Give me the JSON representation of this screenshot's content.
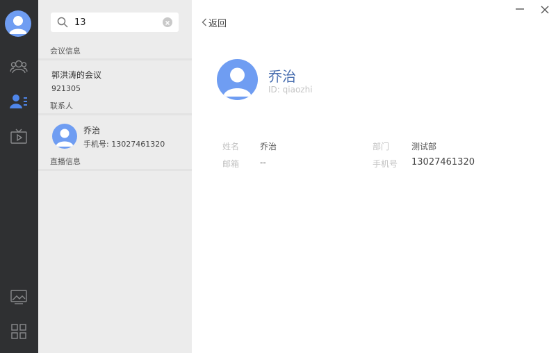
{
  "search": {
    "value": "13"
  },
  "sections": {
    "meetings": "会议信息",
    "contacts": "联系人",
    "live": "直播信息"
  },
  "meeting": {
    "name": "郭洪涛的会议",
    "number": "921305"
  },
  "contact": {
    "name": "乔治",
    "phone_label": "手机号:",
    "phone": "13027461320"
  },
  "back_label": "返回",
  "profile": {
    "name": "乔治",
    "id_label": "ID:",
    "id": "qiaozhi",
    "fields": [
      {
        "label": "姓名",
        "value": "乔治"
      },
      {
        "label": "部门",
        "value": "测试部"
      },
      {
        "label": "邮箱",
        "value": "--"
      },
      {
        "label": "手机号",
        "value": "13027461320"
      }
    ]
  },
  "colors": {
    "rail": "#2f3032",
    "accent": "#6f9df2",
    "panel": "#ececec"
  },
  "icons": [
    "user-avatar-icon",
    "contacts-group-icon",
    "contact-list-icon",
    "live-tv-icon",
    "screen-share-icon",
    "apps-grid-icon",
    "search-icon",
    "clear-icon",
    "chevron-left-icon",
    "minimize-icon",
    "close-icon"
  ]
}
